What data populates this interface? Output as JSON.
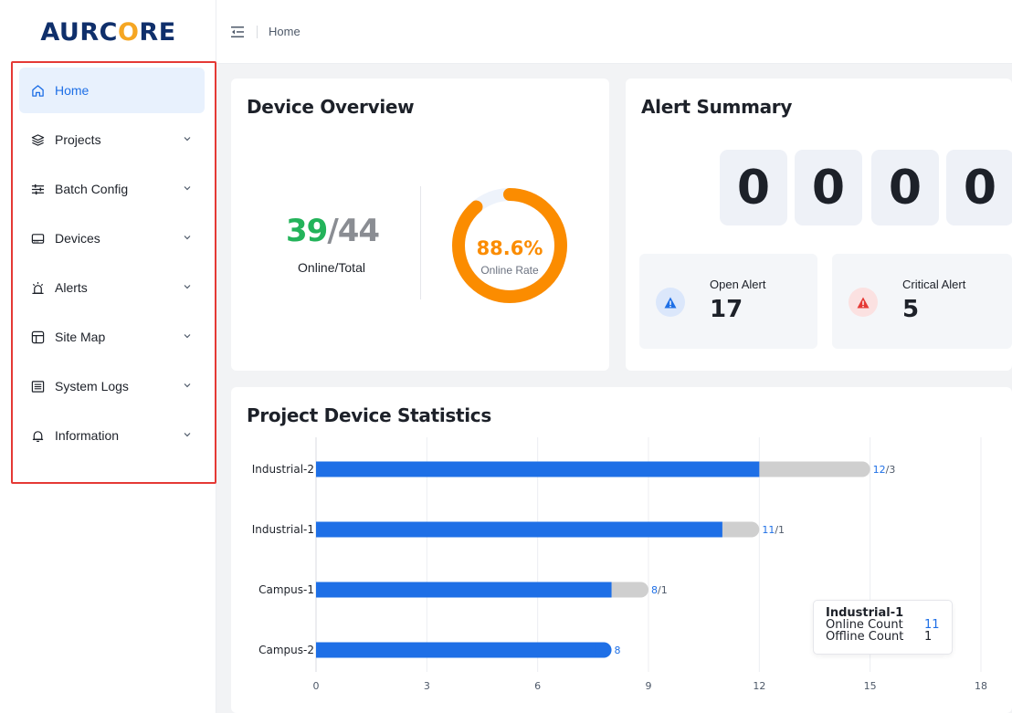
{
  "brand": {
    "part1": "AURC",
    "part2": "O",
    "part3": "RE"
  },
  "topbar": {
    "breadcrumb": "Home"
  },
  "sidebar": {
    "items": [
      {
        "label": "Home",
        "icon": "home-icon",
        "active": true,
        "has_children": false
      },
      {
        "label": "Projects",
        "icon": "layers-icon",
        "active": false,
        "has_children": true
      },
      {
        "label": "Batch Config",
        "icon": "sliders-icon",
        "active": false,
        "has_children": true
      },
      {
        "label": "Devices",
        "icon": "device-icon",
        "active": false,
        "has_children": true
      },
      {
        "label": "Alerts",
        "icon": "alarm-icon",
        "active": false,
        "has_children": true
      },
      {
        "label": "Site Map",
        "icon": "layout-icon",
        "active": false,
        "has_children": true
      },
      {
        "label": "System Logs",
        "icon": "log-icon",
        "active": false,
        "has_children": true
      },
      {
        "label": "Information",
        "icon": "bell-icon",
        "active": false,
        "has_children": true
      }
    ]
  },
  "device_overview": {
    "title": "Device Overview",
    "online": "39",
    "separator": "/",
    "total": "44",
    "online_total_label": "Online/Total",
    "online_rate": "88.6%",
    "online_rate_value": 0.886,
    "online_rate_label": "Online Rate",
    "colors": {
      "online": "#23b35a",
      "ring": "#fb8c00",
      "ring_track": "#eef3fb"
    }
  },
  "alert_summary": {
    "title": "Alert Summary",
    "digits": [
      "0",
      "0",
      "0",
      "0"
    ],
    "open_alert": {
      "label": "Open Alert",
      "value": "17",
      "icon": "warning-icon",
      "color": "#1e6fe6"
    },
    "critical_alert": {
      "label": "Critical Alert",
      "value": "5",
      "icon": "warning-icon",
      "color": "#e53935"
    }
  },
  "project_stats": {
    "title": "Project Device Statistics",
    "tooltip": {
      "title": "Industrial-1",
      "rows": [
        {
          "key": "Online Count",
          "value": "11"
        },
        {
          "key": "Offline Count",
          "value": "1"
        }
      ]
    }
  },
  "chart_data": {
    "type": "bar",
    "orientation": "horizontal",
    "stacked": true,
    "title": "Project Device Statistics",
    "categories": [
      "Industrial-2",
      "Industrial-1",
      "Campus-1",
      "Campus-2"
    ],
    "series": [
      {
        "name": "Online Count",
        "values": [
          12,
          11,
          8,
          8
        ],
        "color": "#1e6fe6"
      },
      {
        "name": "Offline Count",
        "values": [
          3,
          1,
          1,
          0
        ],
        "color": "#cfcfcf"
      }
    ],
    "bar_labels": [
      "12/3",
      "11/1",
      "8/1",
      "8"
    ],
    "xlim": [
      0,
      18
    ],
    "xticks": [
      0,
      3,
      6,
      9,
      12,
      15,
      18
    ],
    "grid": true
  }
}
